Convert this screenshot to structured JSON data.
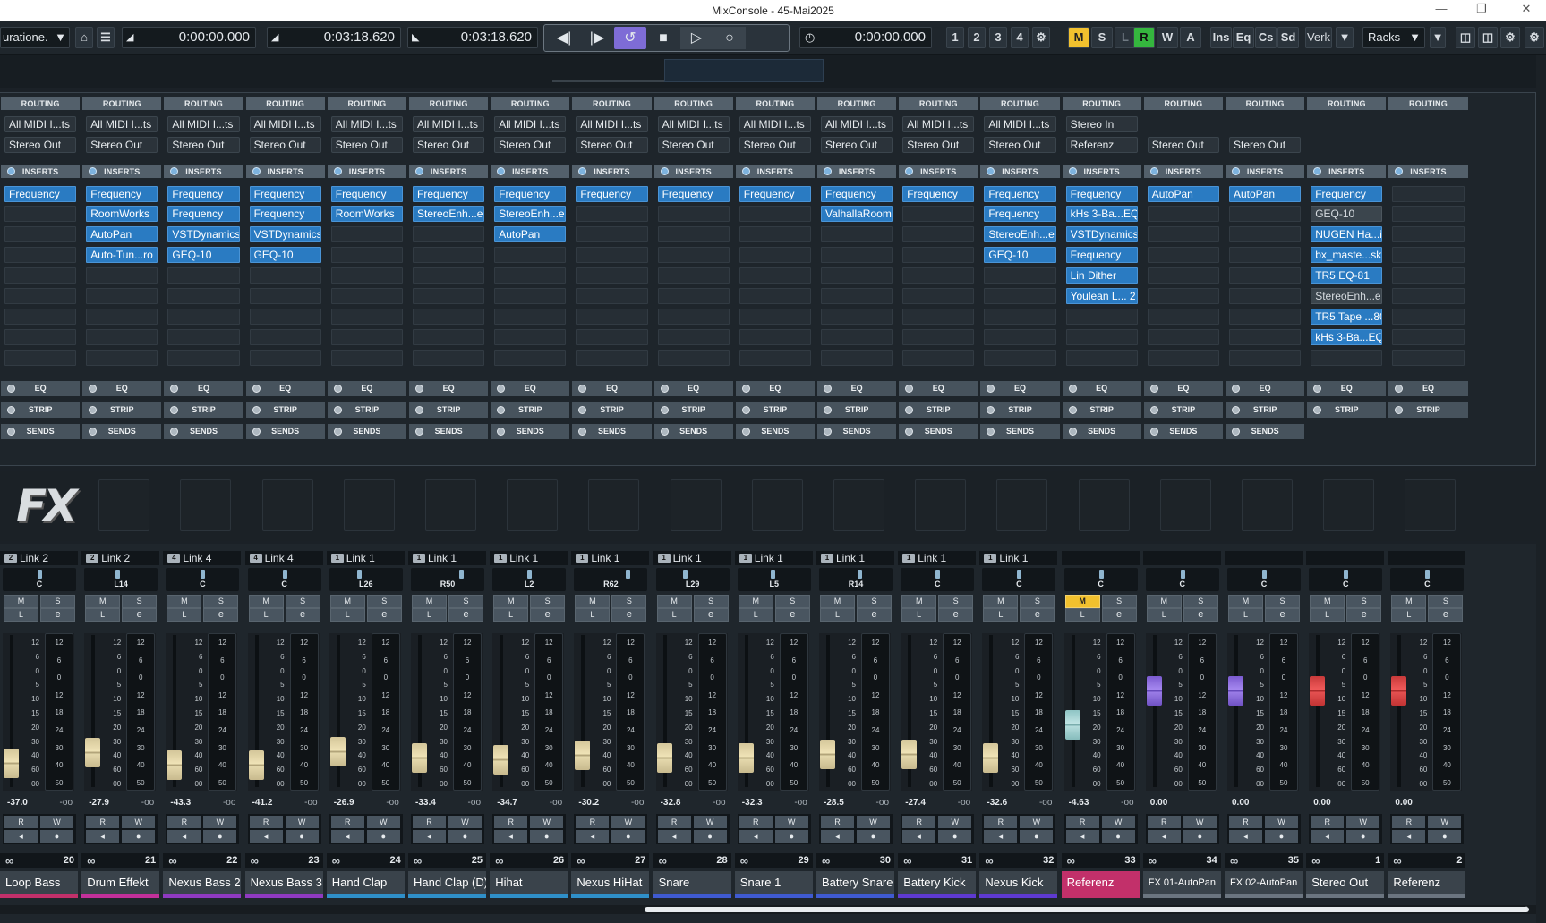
{
  "window": {
    "title": "MixConsole - 45-Mai2025"
  },
  "toolbar": {
    "config_label": "uratione.",
    "time_left": "0:00:00.000",
    "time_left_loc": "0:03:18.620",
    "time_right_loc": "0:03:18.620",
    "time_display": "0:00:00.000",
    "markers": [
      "1",
      "2",
      "3",
      "4"
    ],
    "msrwa": [
      "M",
      "S",
      "L",
      "R",
      "W",
      "A"
    ],
    "view_buttons": [
      "Ins",
      "Eq",
      "Cs",
      "Sd"
    ],
    "verk_label": "Verk",
    "racks_label": "Racks"
  },
  "rack": {
    "routing_label": "ROUTING",
    "inserts_label": "INSERTS",
    "eq_label": "EQ",
    "strip_label": "STRIP",
    "sends_label": "SENDS"
  },
  "fx_logo": "FX",
  "channels": [
    {
      "name": "Loop Bass",
      "num": "20",
      "color": "#c2306a",
      "link": "Link 2",
      "badge": "2",
      "pan": "C",
      "vol": "-37.0",
      "fader": 0.14,
      "in": "All MIDI I...ts",
      "out": "Stereo Out",
      "inserts": [
        "Frequency",
        "",
        "",
        "",
        "",
        "",
        "",
        "",
        ""
      ],
      "type": "norm"
    },
    {
      "name": "Drum Effekt",
      "num": "21",
      "color": "#c2309a",
      "link": "Link 2",
      "badge": "2",
      "pan": "L14",
      "vol": "-27.9",
      "fader": 0.22,
      "in": "All MIDI I...ts",
      "out": "Stereo Out",
      "inserts": [
        "Frequency",
        "RoomWorks",
        "AutoPan",
        "Auto-Tun...ro",
        "",
        "",
        "",
        "",
        ""
      ],
      "type": "norm"
    },
    {
      "name": "Nexus Bass 2",
      "num": "22",
      "color": "#8f3ac0",
      "link": "Link 4",
      "badge": "4",
      "pan": "C",
      "vol": "-43.3",
      "fader": 0.13,
      "in": "All MIDI I...ts",
      "out": "Stereo Out",
      "inserts": [
        "Frequency",
        "Frequency",
        "VSTDynamics",
        "GEQ-10",
        "",
        "",
        "",
        "",
        ""
      ],
      "type": "norm"
    },
    {
      "name": "Nexus Bass 3",
      "num": "23",
      "color": "#8f3ac0",
      "link": "Link 4",
      "badge": "4",
      "pan": "C",
      "vol": "-41.2",
      "fader": 0.13,
      "in": "All MIDI I...ts",
      "out": "Stereo Out",
      "inserts": [
        "Frequency",
        "Frequency",
        "VSTDynamics",
        "GEQ-10",
        "",
        "",
        "",
        "",
        ""
      ],
      "type": "norm"
    },
    {
      "name": "Hand Clap",
      "num": "24",
      "color": "#2f8fc8",
      "link": "Link 1",
      "badge": "1",
      "pan": "L26",
      "vol": "-26.9",
      "fader": 0.23,
      "in": "All MIDI I...ts",
      "out": "Stereo Out",
      "inserts": [
        "Frequency",
        "RoomWorks",
        "",
        "",
        "",
        "",
        "",
        "",
        ""
      ],
      "type": "norm"
    },
    {
      "name": "Hand Clap (D)",
      "num": "25",
      "color": "#2f8fc8",
      "link": "Link 1",
      "badge": "1",
      "pan": "R50",
      "vol": "-33.4",
      "fader": 0.18,
      "in": "All MIDI I...ts",
      "out": "Stereo Out",
      "inserts": [
        "Frequency",
        "StereoEnh...er",
        "",
        "",
        "",
        "",
        "",
        "",
        ""
      ],
      "type": "norm"
    },
    {
      "name": "Hihat",
      "num": "26",
      "color": "#2f8fc8",
      "link": "Link 1",
      "badge": "1",
      "pan": "L2",
      "vol": "-34.7",
      "fader": 0.17,
      "in": "All MIDI I...ts",
      "out": "Stereo Out",
      "inserts": [
        "Frequency",
        "StereoEnh...er",
        "AutoPan",
        "",
        "",
        "",
        "",
        "",
        ""
      ],
      "type": "norm"
    },
    {
      "name": "Nexus HiHat",
      "num": "27",
      "color": "#2f8fc8",
      "link": "Link 1",
      "badge": "1",
      "pan": "R62",
      "vol": "-30.2",
      "fader": 0.2,
      "in": "All MIDI I...ts",
      "out": "Stereo Out",
      "inserts": [
        "Frequency",
        "",
        "",
        "",
        "",
        "",
        "",
        "",
        ""
      ],
      "type": "norm"
    },
    {
      "name": "Snare",
      "num": "28",
      "color": "#3f5ad0",
      "link": "Link 1",
      "badge": "1",
      "pan": "L29",
      "vol": "-32.8",
      "fader": 0.18,
      "in": "All MIDI I...ts",
      "out": "Stereo Out",
      "inserts": [
        "Frequency",
        "",
        "",
        "",
        "",
        "",
        "",
        "",
        ""
      ],
      "type": "norm"
    },
    {
      "name": "Snare 1",
      "num": "29",
      "color": "#3f5ad0",
      "link": "Link 1",
      "badge": "1",
      "pan": "L5",
      "vol": "-32.3",
      "fader": 0.18,
      "in": "All MIDI I...ts",
      "out": "Stereo Out",
      "inserts": [
        "Frequency",
        "",
        "",
        "",
        "",
        "",
        "",
        "",
        ""
      ],
      "type": "norm"
    },
    {
      "name": "Battery Snare",
      "num": "30",
      "color": "#3f5ad0",
      "link": "Link 1",
      "badge": "1",
      "pan": "R14",
      "vol": "-28.5",
      "fader": 0.21,
      "in": "All MIDI I...ts",
      "out": "Stereo Out",
      "inserts": [
        "Frequency",
        "ValhallaRoom",
        "",
        "",
        "",
        "",
        "",
        "",
        ""
      ],
      "type": "norm"
    },
    {
      "name": "Battery Kick",
      "num": "31",
      "color": "#5e3ad0",
      "link": "Link 1",
      "badge": "1",
      "pan": "C",
      "vol": "-27.4",
      "fader": 0.21,
      "in": "All MIDI I...ts",
      "out": "Stereo Out",
      "inserts": [
        "Frequency",
        "",
        "",
        "",
        "",
        "",
        "",
        "",
        ""
      ],
      "type": "norm"
    },
    {
      "name": "Nexus Kick",
      "num": "32",
      "color": "#5e3ad0",
      "link": "Link 1",
      "badge": "1",
      "pan": "C",
      "vol": "-32.6",
      "fader": 0.18,
      "in": "All MIDI I...ts",
      "out": "Stereo Out",
      "inserts": [
        "Frequency",
        "Frequency",
        "StereoEnh...er",
        "GEQ-10",
        "",
        "",
        "",
        "",
        ""
      ],
      "type": "norm"
    },
    {
      "name": "Referenz",
      "num": "33",
      "color": "#c2306a",
      "link": "",
      "badge": "",
      "pan": "C",
      "vol": "-4.63",
      "fader": 0.43,
      "in": "Stereo In",
      "out": "Referenz",
      "inserts": [
        "Frequency",
        "kHs 3-Ba...EQ",
        "VSTDynamics",
        "Frequency",
        "Lin Dither",
        "Youlean L... 2",
        "",
        "",
        ""
      ],
      "type": "grp",
      "mute": true
    },
    {
      "name": "FX 01-AutoPan",
      "num": "34",
      "color": "#6b7580",
      "link": "",
      "badge": "",
      "pan": "C",
      "vol": "0.00",
      "fader": 0.68,
      "in": "",
      "out": "Stereo Out",
      "inserts": [
        "AutoPan",
        "",
        "",
        "",
        "",
        "",
        "",
        "",
        ""
      ],
      "type": "fx"
    },
    {
      "name": "FX 02-AutoPan",
      "num": "35",
      "color": "#6b7580",
      "link": "",
      "badge": "",
      "pan": "C",
      "vol": "0.00",
      "fader": 0.68,
      "in": "",
      "out": "Stereo Out",
      "inserts": [
        "AutoPan",
        "",
        "",
        "",
        "",
        "",
        "",
        "",
        ""
      ],
      "type": "fx"
    },
    {
      "name": "Stereo Out",
      "num": "1",
      "color": "#6b7580",
      "link": "",
      "badge": "",
      "pan": "C",
      "vol": "0.00",
      "fader": 0.68,
      "in": "",
      "out": "",
      "inserts": [
        "Frequency",
        "GEQ-10",
        "NUGEN Ha...it",
        "bx_maste...sk",
        "TR5 EQ-81",
        "StereoEnh...er",
        "TR5 Tape ...80",
        "kHs 3-Ba...EQ",
        ""
      ],
      "type": "out"
    },
    {
      "name": "Referenz",
      "num": "2",
      "color": "#6b7580",
      "link": "",
      "badge": "",
      "pan": "C",
      "vol": "0.00",
      "fader": 0.68,
      "in": "",
      "out": "",
      "inserts": [
        "",
        "",
        "",
        "",
        "",
        "",
        "",
        "",
        ""
      ],
      "type": "out"
    }
  ],
  "fader_scale": [
    "12",
    "6",
    "0",
    "5",
    "10",
    "15",
    "20",
    "30",
    "40",
    "60",
    "00"
  ],
  "meter_scale": [
    "12",
    "6",
    "0",
    "12",
    "18",
    "24",
    "30",
    "40",
    "50"
  ],
  "labels": {
    "M": "M",
    "S": "S",
    "L": "L",
    "R": "R",
    "W": "W",
    "pan_off": "-oo"
  }
}
